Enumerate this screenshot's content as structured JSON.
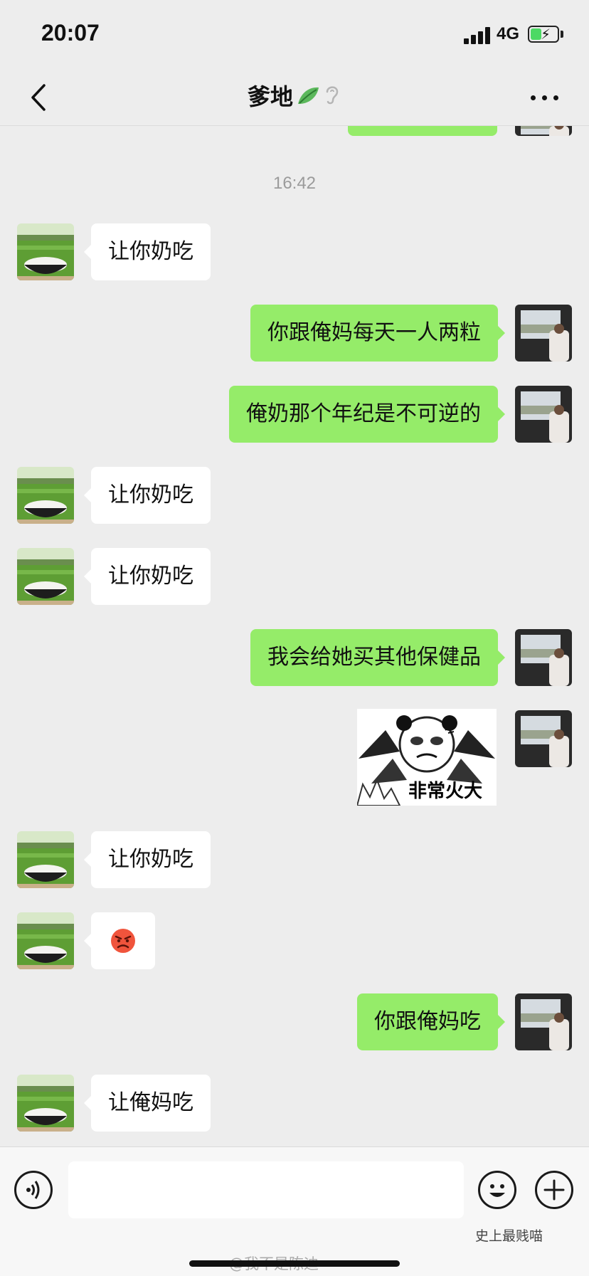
{
  "status_bar": {
    "time": "20:07",
    "network": "4G"
  },
  "header": {
    "title": "爹地"
  },
  "chat": {
    "timestamp": "16:42",
    "messages": [
      {
        "side": "in",
        "text": "让你奶吃"
      },
      {
        "side": "out",
        "text": "你跟俺妈每天一人两粒"
      },
      {
        "side": "out",
        "text": "俺奶那个年纪是不可逆的"
      },
      {
        "side": "in",
        "text": "让你奶吃"
      },
      {
        "side": "in",
        "text": "让你奶吃"
      },
      {
        "side": "out",
        "text": "我会给她买其他保健品"
      },
      {
        "side": "out",
        "type": "sticker",
        "text": "非常火大"
      },
      {
        "side": "in",
        "text": "让你奶吃"
      },
      {
        "side": "in",
        "type": "emoji",
        "text": "😡"
      },
      {
        "side": "out",
        "text": "你跟俺妈吃"
      },
      {
        "side": "in",
        "text": "让俺妈吃"
      }
    ]
  },
  "watermarks": {
    "weibo": "@我不是陈迪",
    "wechat": "史上最贱喵"
  },
  "icons": {
    "back": "chevron-left-icon",
    "leaf": "leaf-icon",
    "ear": "ear-icon",
    "more": "more-icon",
    "voice": "voice-icon",
    "emoji": "emoji-icon",
    "plus": "plus-icon"
  },
  "colors": {
    "outgoing_bubble": "#95ec69",
    "incoming_bubble": "#ffffff",
    "background": "#ededed"
  }
}
